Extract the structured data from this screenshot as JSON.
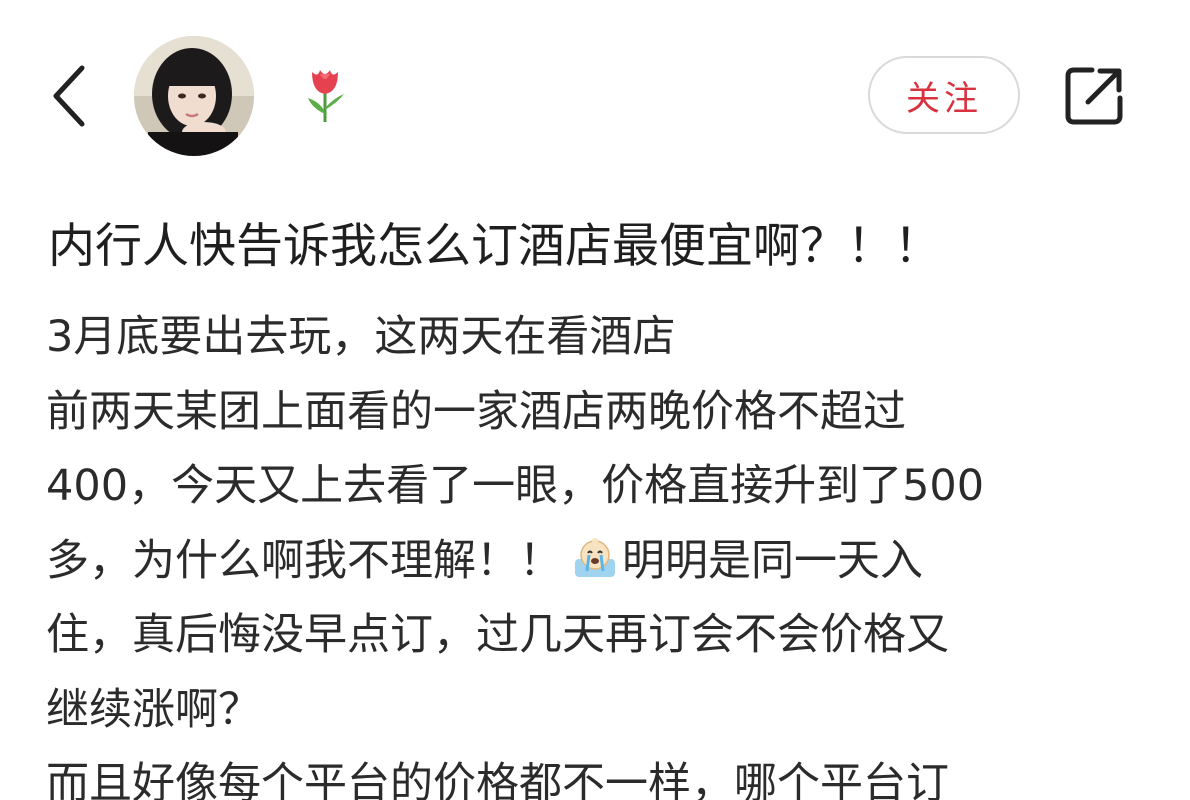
{
  "header": {
    "back_icon": "chevron-left-icon",
    "avatar_icon": "avatar",
    "flower_icon": "tulip-icon",
    "follow_label": "关注",
    "share_icon": "share-icon",
    "accent_color": "#d8323f"
  },
  "post": {
    "title": "内行人快告诉我怎么订酒店最便宜啊？！！",
    "lines": [
      "3月底要出去玩，这两天在看酒店",
      "前两天某团上面看的一家酒店两晚价格不超过",
      "400，今天又上去看了一眼，价格直接升到了500",
      "多，为什么啊我不理解！！",
      "明明是同一天入",
      "住，真后悔没早点订，过几天再订会不会价格又",
      "继续涨啊？",
      "而且好像每个平台的价格都不一样，哪个平台订"
    ],
    "emoji_icon": "crying-emoji-icon"
  }
}
